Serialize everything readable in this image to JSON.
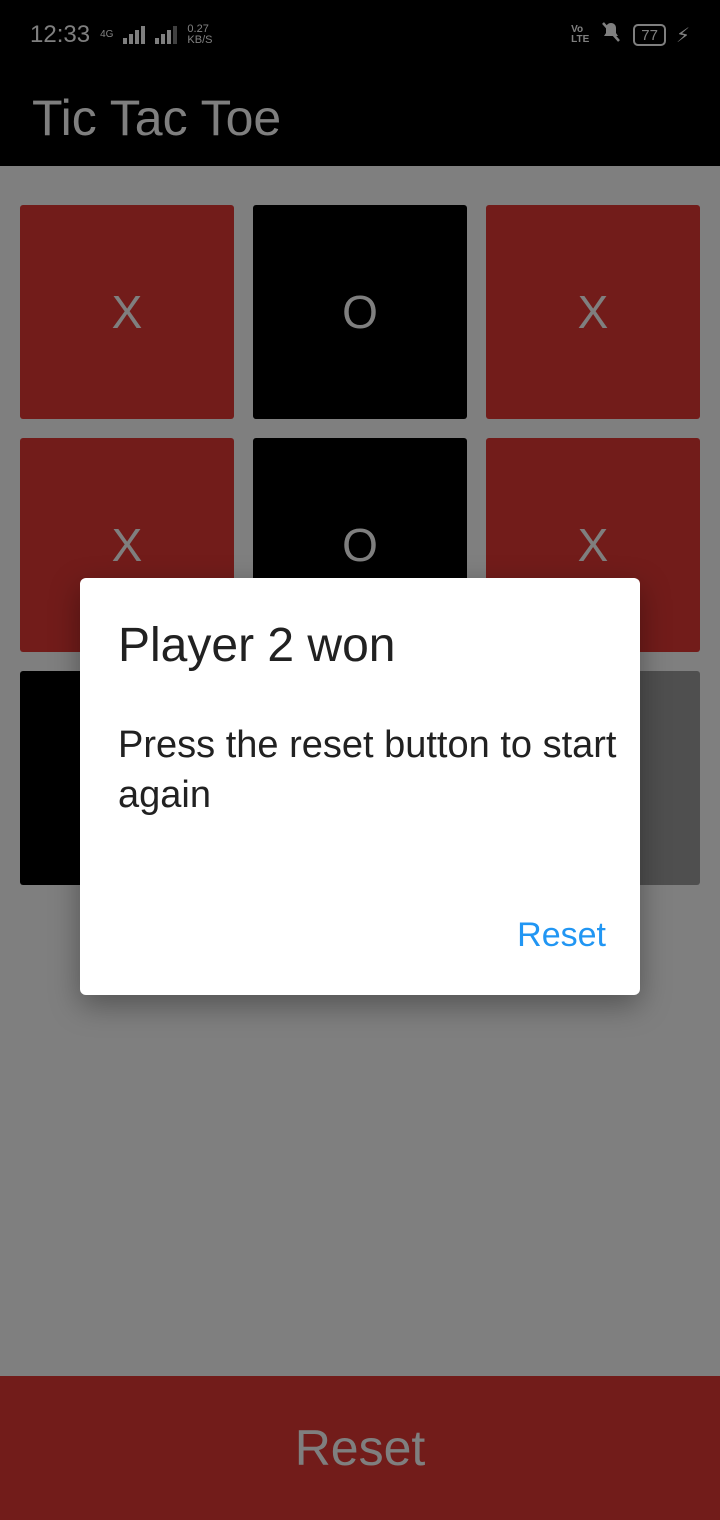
{
  "status_bar": {
    "time": "12:33",
    "network_type": "4G",
    "speed_value": "0.27",
    "speed_unit": "KB/S",
    "volte_top": "Vo",
    "volte_bottom": "LTE",
    "battery": "77",
    "icons": [
      "signal-icon",
      "mute-icon",
      "battery-icon",
      "charging-icon"
    ]
  },
  "app_bar": {
    "title": "Tic Tac Toe"
  },
  "board": {
    "cells": [
      "X",
      "O",
      "X",
      "X",
      "O",
      "X",
      "",
      "",
      ""
    ],
    "colors": {
      "x": "#e53935",
      "o": "#000000",
      "empty": "#9e9e9e"
    }
  },
  "reset_button": {
    "label": "Reset",
    "color": "#e53935"
  },
  "dialog": {
    "title": "Player 2 won",
    "message": "Press the reset button to start again",
    "button_label": "Reset",
    "button_color": "#2196f3"
  }
}
